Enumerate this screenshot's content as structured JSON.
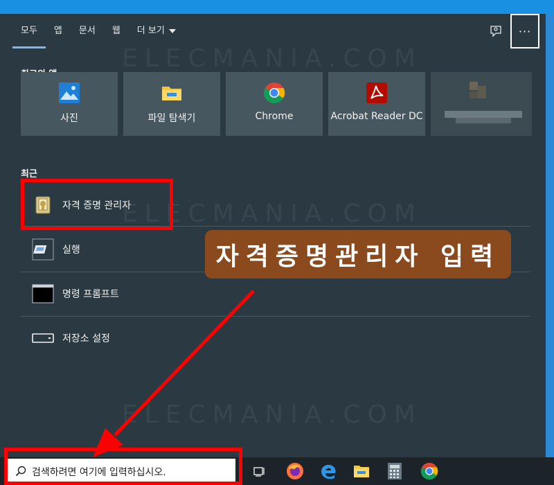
{
  "tabs": [
    {
      "label": "모두"
    },
    {
      "label": "앱"
    },
    {
      "label": "문서"
    },
    {
      "label": "웹"
    },
    {
      "label": "더 보기"
    }
  ],
  "more_button": "···",
  "watermark": "ELECMANIA.COM",
  "top_apps": {
    "title": "최고의 앱",
    "items": [
      {
        "label": "사진",
        "icon": "photos-icon"
      },
      {
        "label": "파일 탐색기",
        "icon": "file-explorer-icon"
      },
      {
        "label": "Chrome",
        "icon": "chrome-icon"
      },
      {
        "label": "Acrobat Reader DC",
        "icon": "acrobat-icon"
      }
    ]
  },
  "recent": {
    "title": "최근",
    "items": [
      {
        "label": "자격 증명 관리자",
        "icon": "credential-manager-icon"
      },
      {
        "label": "실행",
        "icon": "run-icon"
      },
      {
        "label": "명령 프롬프트",
        "icon": "command-prompt-icon"
      },
      {
        "label": "저장소 설정",
        "icon": "storage-icon"
      }
    ]
  },
  "callout": "자격증명관리자 입력",
  "taskbar": {
    "search_placeholder": "검색하려면 여기에 입력하십시오.",
    "icons": [
      "task-view-icon",
      "firefox-icon",
      "edge-icon",
      "file-explorer-icon",
      "calculator-icon",
      "chrome-icon"
    ]
  },
  "colors": {
    "panel": "#2b3a42",
    "tile": "#465760",
    "highlight": "#ff0000",
    "callout": "#8b4a1e",
    "taskbar": "#1c2429"
  }
}
